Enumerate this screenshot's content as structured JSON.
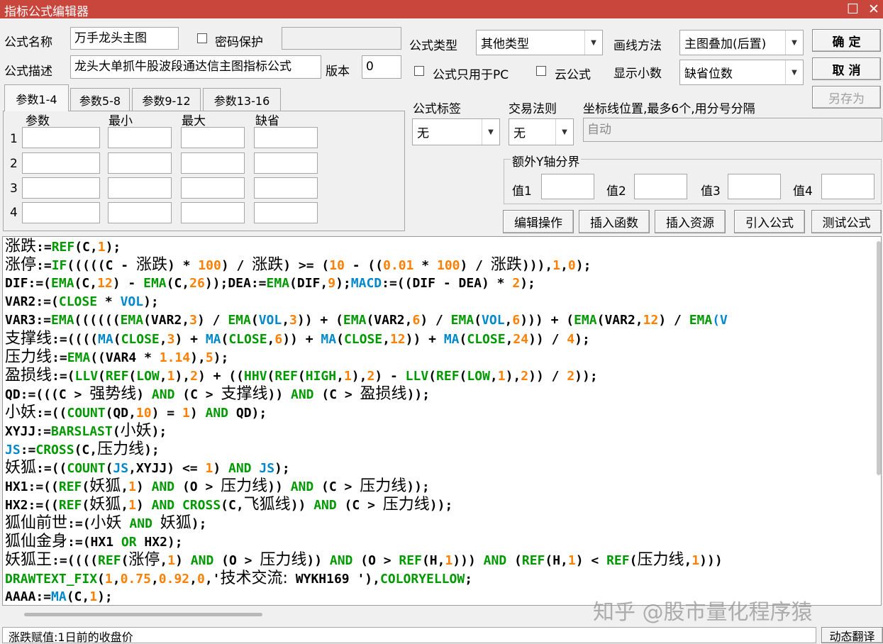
{
  "window": {
    "title": "指标公式编辑器",
    "max_glyph": "☐",
    "close_glyph": "✕"
  },
  "form": {
    "name_label": "公式名称",
    "name_value": "万手龙头主图",
    "password_label": "密码保护",
    "desc_label": "公式描述",
    "desc_value": "龙头大单抓牛股波段通达信主图指标公式",
    "version_label": "版本",
    "version_value": "0",
    "type_label": "公式类型",
    "type_value": "其他类型",
    "draw_label": "画线方法",
    "draw_value": "主图叠加(后置)",
    "pc_only_label": "公式只用于PC",
    "cloud_label": "云公式",
    "decimals_label": "显示小数",
    "decimals_value": "缺省位数",
    "tag_label": "公式标签",
    "tag_value": "无",
    "rule_label": "交易法则",
    "rule_value": "无",
    "axis_label": "坐标线位置,最多6个,用分号分隔",
    "axis_value": "自动",
    "extra_y_label": "额外Y轴分界",
    "y_values": [
      "值1",
      "值2",
      "值3",
      "值4"
    ]
  },
  "buttons": {
    "ok": "确  定",
    "cancel": "取  消",
    "save_as": "另存为",
    "edit_ops": "编辑操作",
    "insert_func": "插入函数",
    "insert_res": "插入资源",
    "import": "引入公式",
    "test": "测试公式",
    "dyn_translate": "动态翻译"
  },
  "tabs": [
    "参数1-4",
    "参数5-8",
    "参数9-12",
    "参数13-16"
  ],
  "params": {
    "headers": [
      "参数",
      "最小",
      "最大",
      "缺省"
    ],
    "rows": [
      "1",
      "2",
      "3",
      "4"
    ]
  },
  "code_lines": [
    [
      [
        "涨跌",
        "cn"
      ],
      [
        ":=",
        "k"
      ],
      [
        "REF",
        "f"
      ],
      [
        "(C,",
        "k"
      ],
      [
        "1",
        "n"
      ],
      [
        ");",
        "k"
      ]
    ],
    [
      [
        "涨停",
        "cn"
      ],
      [
        ":=",
        "k"
      ],
      [
        "IF",
        "f"
      ],
      [
        "(((((C - ",
        "k"
      ],
      [
        "涨跌",
        "cn"
      ],
      [
        ") * ",
        "k"
      ],
      [
        "100",
        "n"
      ],
      [
        ") / ",
        "k"
      ],
      [
        "涨跌",
        "cn"
      ],
      [
        ") >= (",
        "k"
      ],
      [
        "10",
        "n"
      ],
      [
        " - ((",
        "k"
      ],
      [
        "0.01",
        "n"
      ],
      [
        " * ",
        "k"
      ],
      [
        "100",
        "n"
      ],
      [
        ") / ",
        "k"
      ],
      [
        "涨跌",
        "cn"
      ],
      [
        "))),",
        "k"
      ],
      [
        "1",
        "n"
      ],
      [
        ",",
        "k"
      ],
      [
        "0",
        "n"
      ],
      [
        ");",
        "k"
      ]
    ],
    [
      [
        "DIF:=(",
        "k"
      ],
      [
        "EMA",
        "f"
      ],
      [
        "(C,",
        "k"
      ],
      [
        "12",
        "n"
      ],
      [
        ") - ",
        "k"
      ],
      [
        "EMA",
        "f"
      ],
      [
        "(C,",
        "k"
      ],
      [
        "26",
        "n"
      ],
      [
        "));DEA:=",
        "k"
      ],
      [
        "EMA",
        "f"
      ],
      [
        "(DIF,",
        "k"
      ],
      [
        "9",
        "n"
      ],
      [
        ");",
        "k"
      ],
      [
        "MACD",
        "b"
      ],
      [
        ":=((DIF - DEA) * ",
        "k"
      ],
      [
        "2",
        "n"
      ],
      [
        ");",
        "k"
      ]
    ],
    [
      [
        "VAR2:=(",
        "k"
      ],
      [
        "CLOSE",
        "f"
      ],
      [
        " * ",
        "k"
      ],
      [
        "VOL",
        "b"
      ],
      [
        ");",
        "k"
      ]
    ],
    [
      [
        "VAR3:=",
        "k"
      ],
      [
        "EMA",
        "f"
      ],
      [
        "((((((",
        "k"
      ],
      [
        "EMA",
        "f"
      ],
      [
        "(VAR2,",
        "k"
      ],
      [
        "3",
        "n"
      ],
      [
        ") / ",
        "k"
      ],
      [
        "EMA",
        "f"
      ],
      [
        "(",
        "k"
      ],
      [
        "VOL",
        "b"
      ],
      [
        ",",
        "k"
      ],
      [
        "3",
        "n"
      ],
      [
        ")) + (",
        "k"
      ],
      [
        "EMA",
        "f"
      ],
      [
        "(VAR2,",
        "k"
      ],
      [
        "6",
        "n"
      ],
      [
        ") / ",
        "k"
      ],
      [
        "EMA",
        "f"
      ],
      [
        "(",
        "k"
      ],
      [
        "VOL",
        "b"
      ],
      [
        ",",
        "k"
      ],
      [
        "6",
        "n"
      ],
      [
        "))) + (",
        "k"
      ],
      [
        "EMA",
        "f"
      ],
      [
        "(VAR2,",
        "k"
      ],
      [
        "12",
        "n"
      ],
      [
        ") / ",
        "k"
      ],
      [
        "EMA",
        "f"
      ],
      [
        "(V",
        "b"
      ]
    ],
    [
      [
        "支撑线",
        "cn"
      ],
      [
        ":=((((",
        "k"
      ],
      [
        "MA",
        "b"
      ],
      [
        "(",
        "k"
      ],
      [
        "CLOSE",
        "f"
      ],
      [
        ",",
        "k"
      ],
      [
        "3",
        "n"
      ],
      [
        ") + ",
        "k"
      ],
      [
        "MA",
        "b"
      ],
      [
        "(",
        "k"
      ],
      [
        "CLOSE",
        "f"
      ],
      [
        ",",
        "k"
      ],
      [
        "6",
        "n"
      ],
      [
        ")) + ",
        "k"
      ],
      [
        "MA",
        "b"
      ],
      [
        "(",
        "k"
      ],
      [
        "CLOSE",
        "f"
      ],
      [
        ",",
        "k"
      ],
      [
        "12",
        "n"
      ],
      [
        ")) + ",
        "k"
      ],
      [
        "MA",
        "b"
      ],
      [
        "(",
        "k"
      ],
      [
        "CLOSE",
        "f"
      ],
      [
        ",",
        "k"
      ],
      [
        "24",
        "n"
      ],
      [
        ")) / ",
        "k"
      ],
      [
        "4",
        "n"
      ],
      [
        ");",
        "k"
      ]
    ],
    [
      [
        "压力线",
        "cn"
      ],
      [
        ":=",
        "k"
      ],
      [
        "EMA",
        "f"
      ],
      [
        "((VAR4 * ",
        "k"
      ],
      [
        "1.14",
        "n"
      ],
      [
        "),",
        "k"
      ],
      [
        "5",
        "n"
      ],
      [
        ");",
        "k"
      ]
    ],
    [
      [
        "盈损线",
        "cn"
      ],
      [
        ":=(",
        "k"
      ],
      [
        "LLV",
        "f"
      ],
      [
        "(",
        "k"
      ],
      [
        "REF",
        "f"
      ],
      [
        "(",
        "k"
      ],
      [
        "LOW",
        "f"
      ],
      [
        ",",
        "k"
      ],
      [
        "1",
        "n"
      ],
      [
        "),",
        "k"
      ],
      [
        "2",
        "n"
      ],
      [
        ") + ((",
        "k"
      ],
      [
        "HHV",
        "f"
      ],
      [
        "(",
        "k"
      ],
      [
        "REF",
        "f"
      ],
      [
        "(",
        "k"
      ],
      [
        "HIGH",
        "f"
      ],
      [
        ",",
        "k"
      ],
      [
        "1",
        "n"
      ],
      [
        "),",
        "k"
      ],
      [
        "2",
        "n"
      ],
      [
        ") - ",
        "k"
      ],
      [
        "LLV",
        "f"
      ],
      [
        "(",
        "k"
      ],
      [
        "REF",
        "f"
      ],
      [
        "(",
        "k"
      ],
      [
        "LOW",
        "f"
      ],
      [
        ",",
        "k"
      ],
      [
        "1",
        "n"
      ],
      [
        "),",
        "k"
      ],
      [
        "2",
        "n"
      ],
      [
        ")) / ",
        "k"
      ],
      [
        "2",
        "n"
      ],
      [
        "));",
        "k"
      ]
    ],
    [
      [
        "QD:=(((C > ",
        "k"
      ],
      [
        "强势线",
        "cn"
      ],
      [
        ") ",
        "k"
      ],
      [
        "AND",
        "f"
      ],
      [
        " (C > ",
        "k"
      ],
      [
        "支撑线",
        "cn"
      ],
      [
        ")) ",
        "k"
      ],
      [
        "AND",
        "f"
      ],
      [
        " (C > ",
        "k"
      ],
      [
        "盈损线",
        "cn"
      ],
      [
        "));",
        "k"
      ]
    ],
    [
      [
        "小妖",
        "cn"
      ],
      [
        ":=((",
        "k"
      ],
      [
        "COUNT",
        "f"
      ],
      [
        "(QD,",
        "k"
      ],
      [
        "10",
        "n"
      ],
      [
        ") = ",
        "k"
      ],
      [
        "1",
        "n"
      ],
      [
        ") ",
        "k"
      ],
      [
        "AND",
        "f"
      ],
      [
        " QD);",
        "k"
      ]
    ],
    [
      [
        "XYJJ:=",
        "k"
      ],
      [
        "BARSLAST",
        "f"
      ],
      [
        "(",
        "k"
      ],
      [
        "小妖",
        "cn"
      ],
      [
        ");",
        "k"
      ]
    ],
    [
      [
        "JS",
        "b"
      ],
      [
        ":=",
        "k"
      ],
      [
        "CROSS",
        "f"
      ],
      [
        "(C,",
        "k"
      ],
      [
        "压力线",
        "cn"
      ],
      [
        ");",
        "k"
      ]
    ],
    [
      [
        "妖狐",
        "cn"
      ],
      [
        ":=((",
        "k"
      ],
      [
        "COUNT",
        "f"
      ],
      [
        "(",
        "k"
      ],
      [
        "JS",
        "b"
      ],
      [
        ",XYJJ) <= ",
        "k"
      ],
      [
        "1",
        "n"
      ],
      [
        ") ",
        "k"
      ],
      [
        "AND",
        "f"
      ],
      [
        " ",
        "k"
      ],
      [
        "JS",
        "b"
      ],
      [
        ");",
        "k"
      ]
    ],
    [
      [
        "HX1:=((",
        "k"
      ],
      [
        "REF",
        "f"
      ],
      [
        "(",
        "k"
      ],
      [
        "妖狐",
        "cn"
      ],
      [
        ",",
        "k"
      ],
      [
        "1",
        "n"
      ],
      [
        ") ",
        "k"
      ],
      [
        "AND",
        "f"
      ],
      [
        " (O > ",
        "k"
      ],
      [
        "压力线",
        "cn"
      ],
      [
        ")) ",
        "k"
      ],
      [
        "AND",
        "f"
      ],
      [
        " (C > ",
        "k"
      ],
      [
        "压力线",
        "cn"
      ],
      [
        "));",
        "k"
      ]
    ],
    [
      [
        "HX2:=((",
        "k"
      ],
      [
        "REF",
        "f"
      ],
      [
        "(",
        "k"
      ],
      [
        "妖狐",
        "cn"
      ],
      [
        ",",
        "k"
      ],
      [
        "1",
        "n"
      ],
      [
        ") ",
        "k"
      ],
      [
        "AND",
        "f"
      ],
      [
        " ",
        "k"
      ],
      [
        "CROSS",
        "f"
      ],
      [
        "(C,",
        "k"
      ],
      [
        "飞狐线",
        "cn"
      ],
      [
        ")) ",
        "k"
      ],
      [
        "AND",
        "f"
      ],
      [
        " (C > ",
        "k"
      ],
      [
        "压力线",
        "cn"
      ],
      [
        "));",
        "k"
      ]
    ],
    [
      [
        "狐仙前世",
        "cn"
      ],
      [
        ":=(",
        "k"
      ],
      [
        "小妖",
        "cn"
      ],
      [
        " ",
        "k"
      ],
      [
        "AND",
        "f"
      ],
      [
        " ",
        "k"
      ],
      [
        "妖狐",
        "cn"
      ],
      [
        ");",
        "k"
      ]
    ],
    [
      [
        "狐仙金身",
        "cn"
      ],
      [
        ":=(HX1 ",
        "k"
      ],
      [
        "OR",
        "f"
      ],
      [
        " HX2);",
        "k"
      ]
    ],
    [
      [
        "妖狐王",
        "cn"
      ],
      [
        ":=((((",
        "k"
      ],
      [
        "REF",
        "f"
      ],
      [
        "(",
        "k"
      ],
      [
        "涨停",
        "cn"
      ],
      [
        ",",
        "k"
      ],
      [
        "1",
        "n"
      ],
      [
        ") ",
        "k"
      ],
      [
        "AND",
        "f"
      ],
      [
        " (O > ",
        "k"
      ],
      [
        "压力线",
        "cn"
      ],
      [
        ")) ",
        "k"
      ],
      [
        "AND",
        "f"
      ],
      [
        " (O > ",
        "k"
      ],
      [
        "REF",
        "f"
      ],
      [
        "(H,",
        "k"
      ],
      [
        "1",
        "n"
      ],
      [
        "))) ",
        "k"
      ],
      [
        "AND",
        "f"
      ],
      [
        " (",
        "k"
      ],
      [
        "REF",
        "f"
      ],
      [
        "(H,",
        "k"
      ],
      [
        "1",
        "n"
      ],
      [
        ") < ",
        "k"
      ],
      [
        "REF",
        "f"
      ],
      [
        "(",
        "k"
      ],
      [
        "压力线",
        "cn"
      ],
      [
        ",",
        "k"
      ],
      [
        "1",
        "n"
      ],
      [
        ")))",
        "k"
      ]
    ],
    [
      [
        "DRAWTEXT_FIX",
        "f"
      ],
      [
        "(",
        "k"
      ],
      [
        "1",
        "n"
      ],
      [
        ",",
        "k"
      ],
      [
        "0.75",
        "n"
      ],
      [
        ",",
        "k"
      ],
      [
        "0.92",
        "n"
      ],
      [
        ",",
        "k"
      ],
      [
        "0",
        "n"
      ],
      [
        ",'",
        "k"
      ],
      [
        "技术交流:",
        "cn"
      ],
      [
        " WYKH169 '),",
        "k"
      ],
      [
        "COLORYELLOW",
        "f"
      ],
      [
        ";",
        "k"
      ]
    ],
    [
      [
        "AAAA:=",
        "k"
      ],
      [
        "MA",
        "b"
      ],
      [
        "(C,",
        "k"
      ],
      [
        "1",
        "n"
      ],
      [
        ");",
        "k"
      ]
    ]
  ],
  "status_text": "涨跌赋值:1日前的收盘价",
  "watermark": "知乎 @股市量化程序猿"
}
